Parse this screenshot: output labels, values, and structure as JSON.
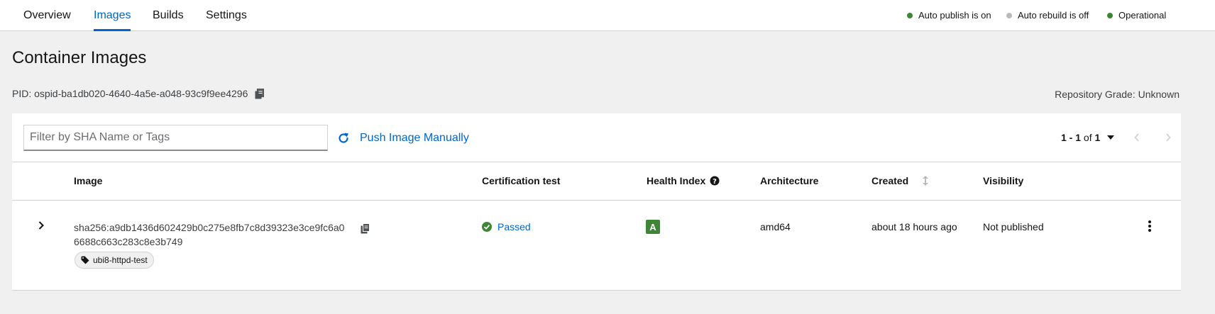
{
  "nav": {
    "tabs": [
      {
        "label": "Overview"
      },
      {
        "label": "Images"
      },
      {
        "label": "Builds"
      },
      {
        "label": "Settings"
      }
    ],
    "active_tab": "Images"
  },
  "status": [
    {
      "label": "Auto publish is on",
      "color": "#3e8635"
    },
    {
      "label": "Auto rebuild is off",
      "color": "#b8bbbe"
    },
    {
      "label": "Operational",
      "color": "#3e8635"
    }
  ],
  "header": {
    "title": "Container Images",
    "pid": "PID: ospid-ba1db020-4640-4a5e-a048-93c9f9ee4296",
    "repository_grade": "Repository Grade: Unknown"
  },
  "toolbar": {
    "filter_placeholder": "Filter by SHA Name or Tags",
    "push_label": "Push Image Manually",
    "pagination": {
      "range": "1 - 1",
      "of": "of",
      "total": "1"
    }
  },
  "table": {
    "columns": [
      "Image",
      "Certification test",
      "Health Index",
      "Architecture",
      "Created",
      "Visibility"
    ],
    "rows": [
      {
        "sha_line1": "sha256:a9db1436d602429b0c275e8fb7c8d39323e3ce9fc6a0",
        "sha_line2": "6688c663c283c8e3b749",
        "tag": "ubi8-httpd-test",
        "certification": "Passed",
        "health_index": "A",
        "architecture": "amd64",
        "created": "about 18 hours ago",
        "visibility": "Not published"
      }
    ]
  },
  "colors": {
    "link": "#0066cc",
    "success": "#3e8635",
    "border": "#d2d2d2"
  }
}
